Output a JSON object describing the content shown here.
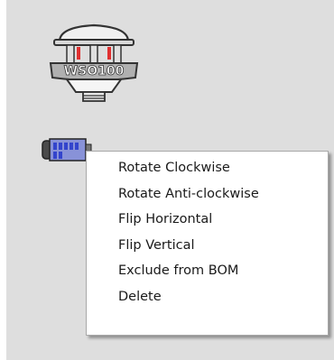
{
  "device": {
    "sensor_label": "WSO100",
    "sensor_color": "#b0b0b0",
    "accent_red": "#e03030",
    "connector_color": "#5b6bd6"
  },
  "context_menu": {
    "items": [
      {
        "label": "Rotate Clockwise"
      },
      {
        "label": "Rotate Anti-clockwise"
      },
      {
        "label": "Flip Horizontal"
      },
      {
        "label": "Flip Vertical"
      },
      {
        "label": "Exclude from BOM"
      },
      {
        "label": "Delete"
      }
    ]
  }
}
